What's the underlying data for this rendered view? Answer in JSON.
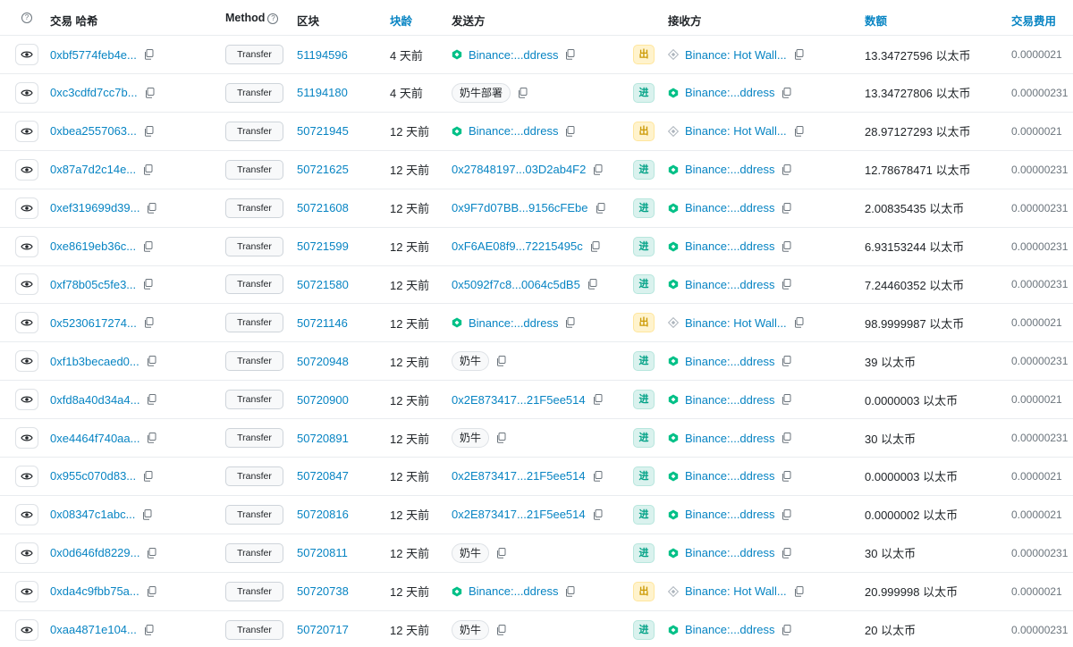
{
  "header": {
    "tx_hash": "交易 哈希",
    "method": "Method",
    "block": "区块",
    "age": "块龄",
    "from": "发送方",
    "to": "接收方",
    "amount": "数额",
    "fee": "交易费用",
    "help_glyph": "?"
  },
  "colors": {
    "link": "#0784c3",
    "out_badge_bg": "#fff3cd",
    "in_badge_bg": "#daf2ee",
    "binance_yellow": "#f0b90b",
    "binance_green": "#00c087"
  },
  "rows": [
    {
      "hash": "0xbf5774feb4e...",
      "method": "Transfer",
      "block": "51194596",
      "age": "4 天前",
      "from": "Binance:...ddress",
      "from_type": "binance",
      "dir": "出",
      "dir_type": "out",
      "to": "Binance: Hot Wall...",
      "to_type": "hot",
      "amount": "13.34727596 以太币",
      "fee": "0.0000021"
    },
    {
      "hash": "0xc3cdfd7cc7b...",
      "method": "Transfer",
      "block": "51194180",
      "age": "4 天前",
      "from": "奶牛部署",
      "from_type": "pill",
      "dir": "进",
      "dir_type": "in",
      "to": "Binance:...ddress",
      "to_type": "binance",
      "amount": "13.34727806 以太币",
      "fee": "0.00000231"
    },
    {
      "hash": "0xbea2557063...",
      "method": "Transfer",
      "block": "50721945",
      "age": "12 天前",
      "from": "Binance:...ddress",
      "from_type": "binance",
      "dir": "出",
      "dir_type": "out",
      "to": "Binance: Hot Wall...",
      "to_type": "hot",
      "amount": "28.97127293 以太币",
      "fee": "0.0000021"
    },
    {
      "hash": "0x87a7d2c14e...",
      "method": "Transfer",
      "block": "50721625",
      "age": "12 天前",
      "from": "0x27848197...03D2ab4F2",
      "from_type": "addr",
      "dir": "进",
      "dir_type": "in",
      "to": "Binance:...ddress",
      "to_type": "binance",
      "amount": "12.78678471 以太币",
      "fee": "0.00000231"
    },
    {
      "hash": "0xef319699d39...",
      "method": "Transfer",
      "block": "50721608",
      "age": "12 天前",
      "from": "0x9F7d07BB...9156cFEbe",
      "from_type": "addr",
      "dir": "进",
      "dir_type": "in",
      "to": "Binance:...ddress",
      "to_type": "binance",
      "amount": "2.00835435 以太币",
      "fee": "0.00000231"
    },
    {
      "hash": "0xe8619eb36c...",
      "method": "Transfer",
      "block": "50721599",
      "age": "12 天前",
      "from": "0xF6AE08f9...72215495c",
      "from_type": "addr",
      "dir": "进",
      "dir_type": "in",
      "to": "Binance:...ddress",
      "to_type": "binance",
      "amount": "6.93153244 以太币",
      "fee": "0.00000231"
    },
    {
      "hash": "0xf78b05c5fe3...",
      "method": "Transfer",
      "block": "50721580",
      "age": "12 天前",
      "from": "0x5092f7c8...0064c5dB5",
      "from_type": "addr",
      "dir": "进",
      "dir_type": "in",
      "to": "Binance:...ddress",
      "to_type": "binance",
      "amount": "7.24460352 以太币",
      "fee": "0.00000231"
    },
    {
      "hash": "0x5230617274...",
      "method": "Transfer",
      "block": "50721146",
      "age": "12 天前",
      "from": "Binance:...ddress",
      "from_type": "binance",
      "dir": "出",
      "dir_type": "out",
      "to": "Binance: Hot Wall...",
      "to_type": "hot",
      "amount": "98.9999987 以太币",
      "fee": "0.0000021"
    },
    {
      "hash": "0xf1b3becaed0...",
      "method": "Transfer",
      "block": "50720948",
      "age": "12 天前",
      "from": "奶牛",
      "from_type": "pill",
      "dir": "进",
      "dir_type": "in",
      "to": "Binance:...ddress",
      "to_type": "binance",
      "amount": "39 以太币",
      "fee": "0.00000231"
    },
    {
      "hash": "0xfd8a40d34a4...",
      "method": "Transfer",
      "block": "50720900",
      "age": "12 天前",
      "from": "0x2E873417...21F5ee514",
      "from_type": "addr",
      "dir": "进",
      "dir_type": "in",
      "to": "Binance:...ddress",
      "to_type": "binance",
      "amount": "0.0000003 以太币",
      "fee": "0.0000021"
    },
    {
      "hash": "0xe4464f740aa...",
      "method": "Transfer",
      "block": "50720891",
      "age": "12 天前",
      "from": "奶牛",
      "from_type": "pill",
      "dir": "进",
      "dir_type": "in",
      "to": "Binance:...ddress",
      "to_type": "binance",
      "amount": "30 以太币",
      "fee": "0.00000231"
    },
    {
      "hash": "0x955c070d83...",
      "method": "Transfer",
      "block": "50720847",
      "age": "12 天前",
      "from": "0x2E873417...21F5ee514",
      "from_type": "addr",
      "dir": "进",
      "dir_type": "in",
      "to": "Binance:...ddress",
      "to_type": "binance",
      "amount": "0.0000003 以太币",
      "fee": "0.0000021"
    },
    {
      "hash": "0x08347c1abc...",
      "method": "Transfer",
      "block": "50720816",
      "age": "12 天前",
      "from": "0x2E873417...21F5ee514",
      "from_type": "addr",
      "dir": "进",
      "dir_type": "in",
      "to": "Binance:...ddress",
      "to_type": "binance",
      "amount": "0.0000002 以太币",
      "fee": "0.0000021"
    },
    {
      "hash": "0x0d646fd8229...",
      "method": "Transfer",
      "block": "50720811",
      "age": "12 天前",
      "from": "奶牛",
      "from_type": "pill",
      "dir": "进",
      "dir_type": "in",
      "to": "Binance:...ddress",
      "to_type": "binance",
      "amount": "30 以太币",
      "fee": "0.00000231"
    },
    {
      "hash": "0xda4c9fbb75a...",
      "method": "Transfer",
      "block": "50720738",
      "age": "12 天前",
      "from": "Binance:...ddress",
      "from_type": "binance",
      "dir": "出",
      "dir_type": "out",
      "to": "Binance: Hot Wall...",
      "to_type": "hot",
      "amount": "20.999998 以太币",
      "fee": "0.0000021"
    },
    {
      "hash": "0xaa4871e104...",
      "method": "Transfer",
      "block": "50720717",
      "age": "12 天前",
      "from": "奶牛",
      "from_type": "pill",
      "dir": "进",
      "dir_type": "in",
      "to": "Binance:...ddress",
      "to_type": "binance",
      "amount": "20 以太币",
      "fee": "0.00000231"
    }
  ]
}
